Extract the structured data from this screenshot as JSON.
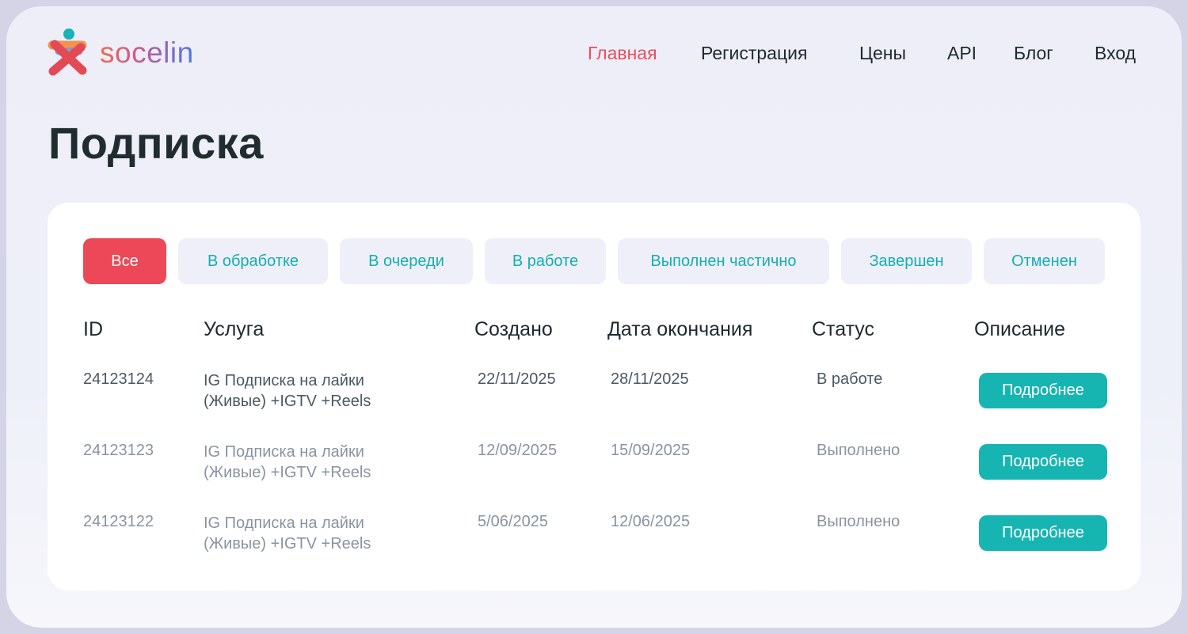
{
  "brand": {
    "name": "socelin"
  },
  "nav": {
    "items": [
      {
        "label": "Главная",
        "active": true
      },
      {
        "label": "Регистрация"
      },
      {
        "label": "Цены"
      },
      {
        "label": "API"
      },
      {
        "label": "Блог"
      },
      {
        "label": "Вход"
      }
    ]
  },
  "page": {
    "title": "Подписка"
  },
  "filters": [
    {
      "label": "Все",
      "active": true
    },
    {
      "label": "В обработке"
    },
    {
      "label": "В очереди"
    },
    {
      "label": "В работе"
    },
    {
      "label": "Выполнен частично"
    },
    {
      "label": "Завершен"
    },
    {
      "label": "Отменен"
    }
  ],
  "table": {
    "headers": [
      "ID",
      "Услуга",
      "Создано",
      "Дата окончания",
      "Статус",
      "Описание"
    ],
    "rows": [
      {
        "id": "24123124",
        "service_line1": "IG Подписка на лайки",
        "service_line2": "(Живые) +IGTV +Reels",
        "created": "22/11/2025",
        "ends": "28/11/2025",
        "status": "В работе",
        "action": "Подробнее"
      },
      {
        "id": "24123123",
        "service_line1": "IG Подписка на лайки",
        "service_line2": "(Живые) +IGTV +Reels",
        "created": "12/09/2025",
        "ends": "15/09/2025",
        "status": "Выполнено",
        "action": "Подробнее"
      },
      {
        "id": "24123122",
        "service_line1": "IG Подписка на лайки",
        "service_line2": "(Живые) +IGTV +Reels",
        "created": "5/06/2025",
        "ends": "12/06/2025",
        "status": "Выполнено",
        "action": "Подробнее"
      }
    ]
  },
  "colors": {
    "accent_red": "#ed4857",
    "accent_teal": "#16b5b2",
    "background": "#eeeef9"
  }
}
